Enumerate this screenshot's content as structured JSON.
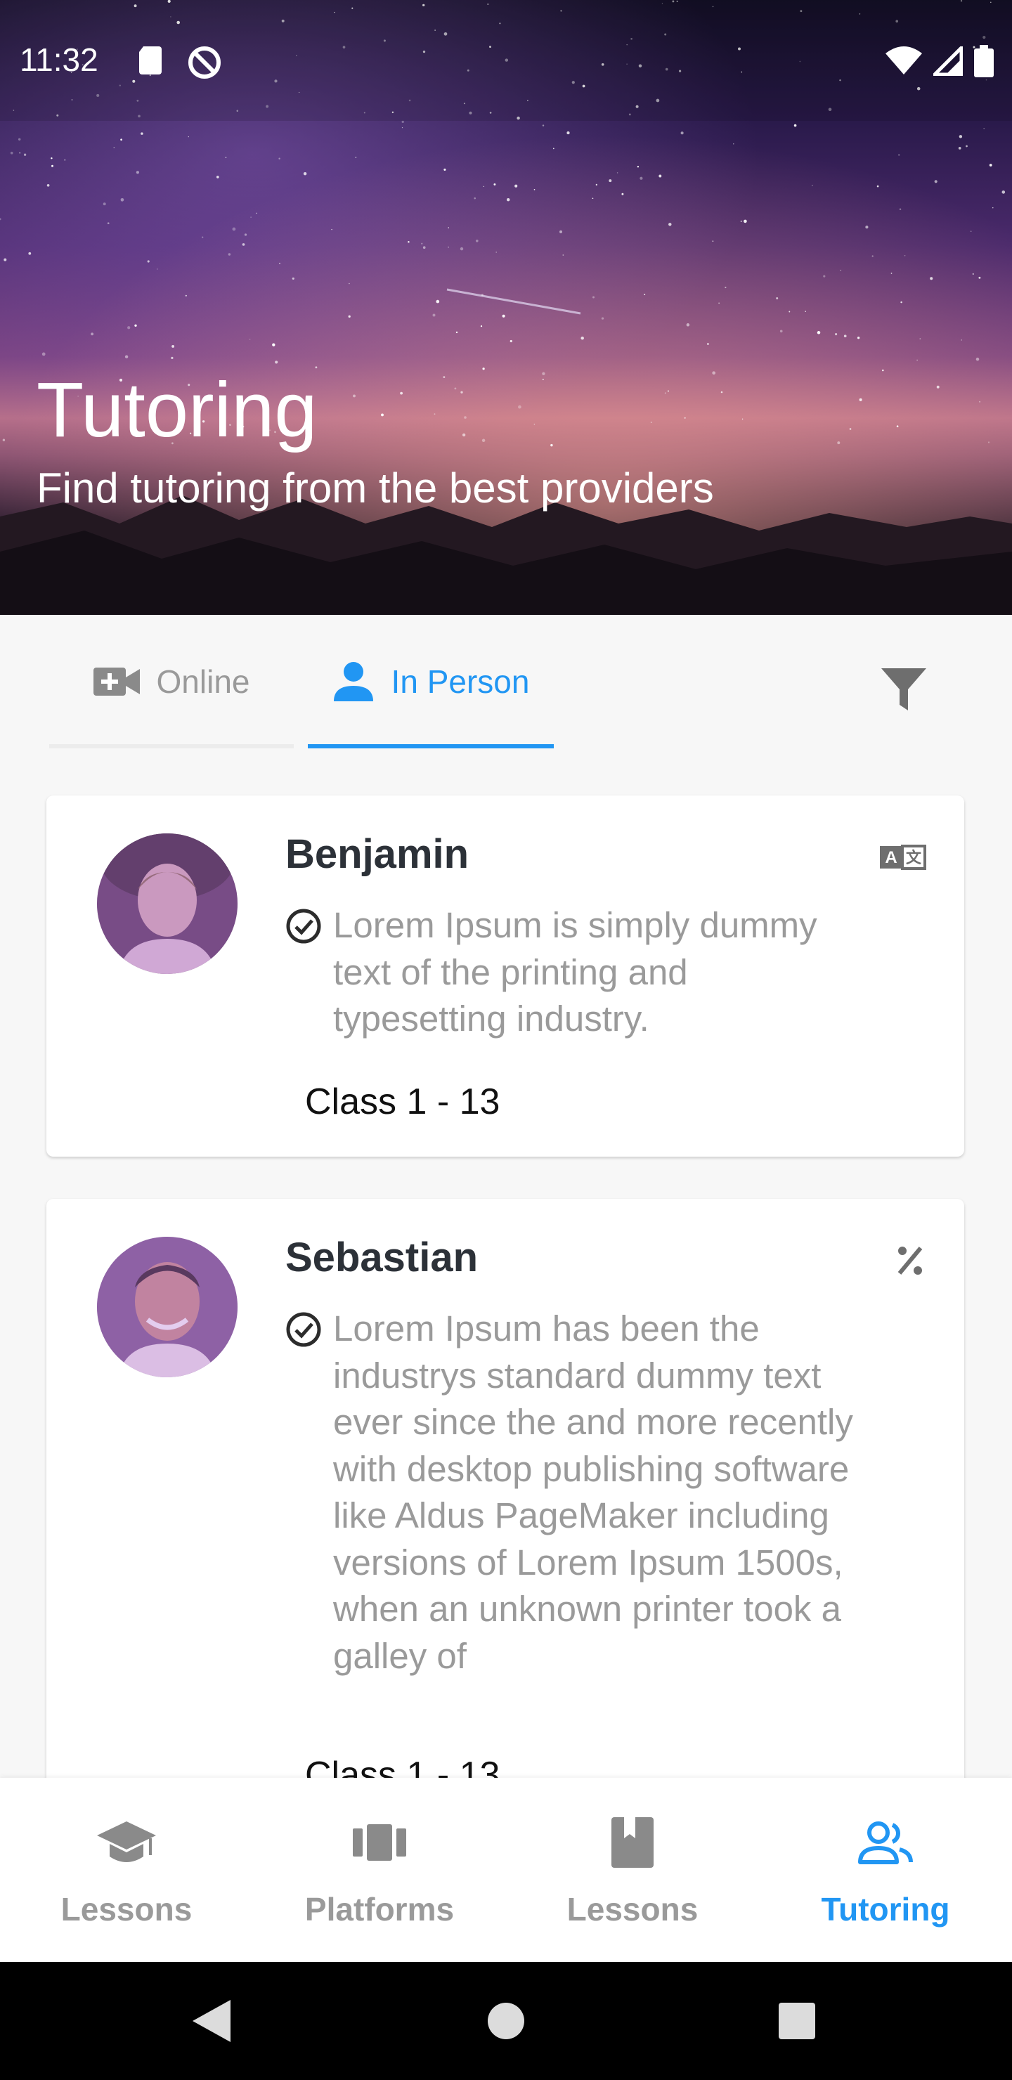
{
  "status_bar": {
    "time": "11:32"
  },
  "hero": {
    "title": "Tutoring",
    "subtitle": "Find tutoring from the best providers"
  },
  "tabs": [
    {
      "label": "Online",
      "icon": "video-camera-icon",
      "selected": false
    },
    {
      "label": "In Person",
      "icon": "person-icon",
      "selected": true
    }
  ],
  "tutors": [
    {
      "name": "Benjamin",
      "description": "Lorem Ipsum is simply dummy text of the printing and typesetting industry.",
      "class_range": "Class 1 - 13",
      "badge_icon": "translate-icon"
    },
    {
      "name": "Sebastian",
      "description": "Lorem Ipsum has been the industrys standard dummy text ever since the and more recently with desktop publishing software like Aldus PageMaker including versions of Lorem Ipsum 1500s, when an unknown printer took a galley of",
      "class_range": "Class 1 - 13",
      "badge_icon": "percent-icon"
    }
  ],
  "bottom_nav": [
    {
      "label": "Lessons",
      "icon": "graduation-cap-icon",
      "active": false
    },
    {
      "label": "Platforms",
      "icon": "platforms-icon",
      "active": false
    },
    {
      "label": "Lessons",
      "icon": "book-icon",
      "active": false
    },
    {
      "label": "Tutoring",
      "icon": "people-icon",
      "active": true
    }
  ],
  "colors": {
    "accent": "#2196f3",
    "muted_text": "#9a9a9a",
    "name_text": "#2c3138"
  }
}
